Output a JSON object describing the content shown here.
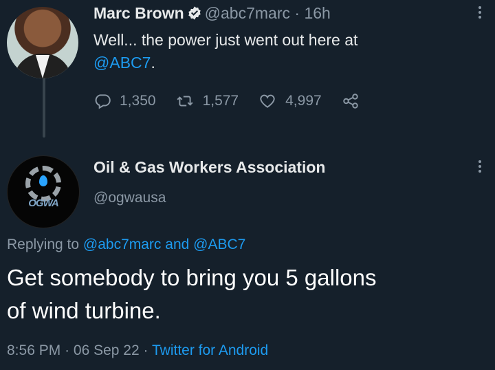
{
  "tweet1": {
    "author_name": "Marc Brown",
    "author_handle": "@abc7marc",
    "separator": "·",
    "time_ago": "16h",
    "text_prefix": "Well... the power just went out here at",
    "mention": "@ABC7",
    "text_suffix": ".",
    "replies": "1,350",
    "retweets": "1,577",
    "likes": "4,997"
  },
  "tweet2": {
    "author_name": "Oil & Gas Workers Association",
    "author_handle": "@ogwausa",
    "logo_text": "OGWA",
    "replying_label": "Replying to",
    "replying_user1": "@abc7marc",
    "replying_and": "and",
    "replying_user2": "@ABC7",
    "text_line1": "Get somebody to bring you 5 gallons",
    "text_line2": "of wind turbine.",
    "time": "8:56 PM",
    "separator1": "·",
    "date": "06 Sep 22",
    "separator2": "·",
    "source": "Twitter for Android"
  },
  "colors": {
    "background": "#15202b",
    "text": "#e7e9ea",
    "muted": "#8b98a5",
    "link": "#1d9bf0",
    "verified": "#1d9bf0"
  },
  "icons": [
    "verified-icon",
    "more-options-icon",
    "reply-icon",
    "retweet-icon",
    "like-icon",
    "share-icon"
  ]
}
